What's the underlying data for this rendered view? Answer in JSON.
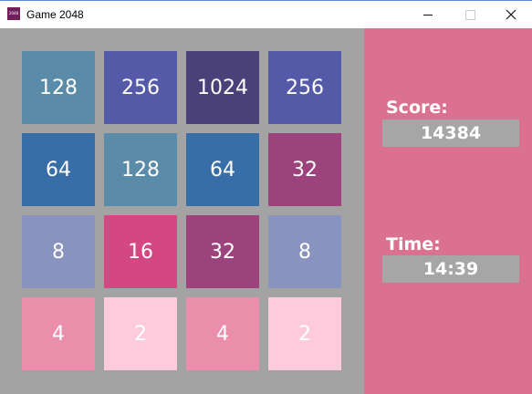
{
  "window": {
    "title": "Game 2048",
    "icon_name": "game-2048-app-icon",
    "icon_text": "2048"
  },
  "board": {
    "tiles": [
      {
        "value": "128",
        "color": "#5a8ba8"
      },
      {
        "value": "256",
        "color": "#5459a8"
      },
      {
        "value": "1024",
        "color": "#4a4178"
      },
      {
        "value": "256",
        "color": "#5459a8"
      },
      {
        "value": "64",
        "color": "#376ea8"
      },
      {
        "value": "128",
        "color": "#5a8ba8"
      },
      {
        "value": "64",
        "color": "#376ea8"
      },
      {
        "value": "32",
        "color": "#9c437e"
      },
      {
        "value": "8",
        "color": "#8893c0"
      },
      {
        "value": "16",
        "color": "#d34783"
      },
      {
        "value": "32",
        "color": "#9c437e"
      },
      {
        "value": "8",
        "color": "#8893c0"
      },
      {
        "value": "4",
        "color": "#eb8eab"
      },
      {
        "value": "2",
        "color": "#fdcbdc"
      },
      {
        "value": "4",
        "color": "#eb8eab"
      },
      {
        "value": "2",
        "color": "#fdcbdc"
      }
    ]
  },
  "side_panel": {
    "score_label": "Score:",
    "score_value": "14384",
    "time_label": "Time:",
    "time_value": "14:39"
  },
  "colors": {
    "board_background": "#a3a3a3",
    "panel_background": "#db7191",
    "value_box_background": "#a6a6a6"
  }
}
